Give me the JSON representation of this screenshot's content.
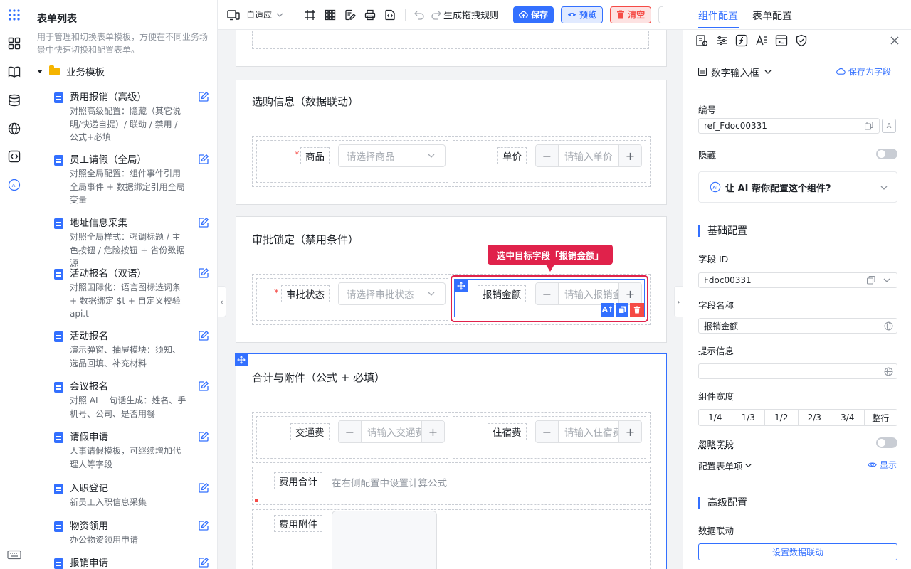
{
  "sidebar": {
    "title": "表单列表",
    "description": "用于管理和切换表单模板，方便在不同业务场景中快速切换和配置表单。",
    "folder": "业务模板",
    "templates": [
      {
        "name": "费用报销（高级）",
        "desc": "对照高级配置：隐藏（其它说明/快递自提）/ 联动 / 禁用 / 公式+必填"
      },
      {
        "name": "员工请假（全局）",
        "desc": "对照全局配置：组件事件引用全局事件 + 数据绑定引用全局变量"
      },
      {
        "name": "地址信息采集",
        "desc": "对照全局样式：强调标题 / 主色按钮 / 危险按钮 + 省份数据源"
      },
      {
        "name": "活动报名（双语）",
        "desc": "对照国际化：语言图标选词条 + 数据绑定 $t + 自定义校验 api.t"
      },
      {
        "name": "活动报名",
        "desc": "演示弹窗、抽屉模块：须知、选品回填、补充材料"
      },
      {
        "name": "会议报名",
        "desc": "对照 AI 一句话生成：姓名、手机号、公司、是否用餐"
      },
      {
        "name": "请假申请",
        "desc": "人事请假模板，可继续增加代理人等字段"
      },
      {
        "name": "入职登记",
        "desc": "新员工入职信息采集"
      },
      {
        "name": "物资领用",
        "desc": "办公物资领用申请"
      },
      {
        "name": "报销申请",
        "desc": ""
      }
    ]
  },
  "toolbar": {
    "adaptive_label": "自适应",
    "generate_rule": "生成拖拽规则",
    "save": "保存",
    "preview": "预览",
    "clear": "清空"
  },
  "canvas": {
    "section1": {
      "title": "选购信息（数据联动）",
      "product_label": "商品",
      "product_placeholder": "请选择商品",
      "price_label": "单价",
      "price_placeholder": "请输入单价"
    },
    "section2": {
      "title": "审批锁定（禁用条件）",
      "status_label": "审批状态",
      "status_placeholder": "请选择审批状态",
      "amount_label": "报销金额",
      "amount_placeholder": "请输入报销金额"
    },
    "callout": "选中目标字段「报销金额」",
    "section3": {
      "title": "合计与附件（公式 + 必填）",
      "transport_label": "交通费",
      "transport_placeholder": "请输入交通费",
      "hotel_label": "住宿费",
      "hotel_placeholder": "请输入住宿费",
      "total_label": "费用合计",
      "total_hint": "在右侧配置中设置计算公式",
      "attachment_label": "费用附件"
    }
  },
  "panel": {
    "tab_component": "组件配置",
    "tab_form": "表单配置",
    "component_type": "数字输入框",
    "save_as_field": "保存为字段",
    "id_label": "编号",
    "id_value": "ref_Fdoc00331",
    "hidden_label": "隐藏",
    "ai_prompt": "让 AI 帮你配置这个组件?",
    "basic_section": "基础配置",
    "field_id_label": "字段 ID",
    "field_id_value": "Fdoc00331",
    "field_name_label": "字段名称",
    "field_name_value": "报销金额",
    "hint_label": "提示信息",
    "hint_value": "",
    "width_label": "组件宽度",
    "width_options": [
      "1/4",
      "1/3",
      "1/2",
      "2/3",
      "3/4",
      "整行"
    ],
    "ignore_label": "忽略字段",
    "config_items_label": "配置表单项",
    "show_label": "显示",
    "advanced_section": "高级配置",
    "linkage_label": "数据联动",
    "linkage_button": "设置数据联动"
  },
  "colors": {
    "primary": "#3370ff",
    "danger": "#f54a45",
    "callout": "#e0224b"
  }
}
